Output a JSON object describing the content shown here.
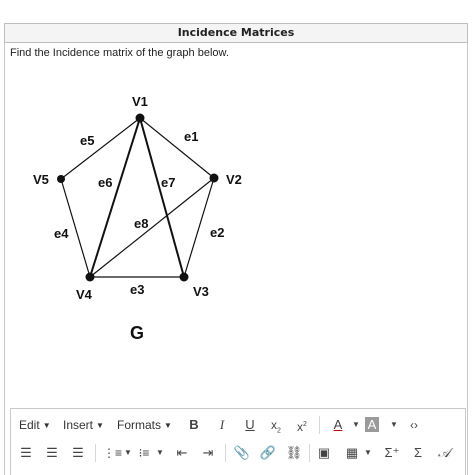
{
  "panel": {
    "title": "Incidence Matrices",
    "question": "Find the Incidence matrix of the graph below."
  },
  "graph": {
    "vertices": [
      {
        "id": "v1",
        "label": "V1"
      },
      {
        "id": "v2",
        "label": "V2"
      },
      {
        "id": "v3",
        "label": "V3"
      },
      {
        "id": "v4",
        "label": "V4"
      },
      {
        "id": "v5",
        "label": "V5"
      }
    ],
    "edges": [
      {
        "id": "e1",
        "label": "e1",
        "from": "v1",
        "to": "v2"
      },
      {
        "id": "e2",
        "label": "e2",
        "from": "v2",
        "to": "v3"
      },
      {
        "id": "e3",
        "label": "e3",
        "from": "v3",
        "to": "v4"
      },
      {
        "id": "e4",
        "label": "e4",
        "from": "v4",
        "to": "v5"
      },
      {
        "id": "e5",
        "label": "e5",
        "from": "v5",
        "to": "v1"
      },
      {
        "id": "e6",
        "label": "e6",
        "from": "v1",
        "to": "v4"
      },
      {
        "id": "e7",
        "label": "e7",
        "from": "v1",
        "to": "v3"
      },
      {
        "id": "e8",
        "label": "e8",
        "from": "v4",
        "to": "v2"
      }
    ],
    "graph_name": "G"
  },
  "toolbar": {
    "edit_label": "Edit",
    "insert_label": "Insert",
    "formats_label": "Formats",
    "row1_icons": [
      "bold-icon",
      "italic-icon",
      "underline-icon",
      "subscript-icon",
      "superscript-icon",
      "text-color-icon",
      "background-color-icon",
      "code-view-icon"
    ],
    "row2_icons": [
      "align-left-icon",
      "align-center-icon",
      "align-right-icon",
      "bullet-list-icon",
      "numbered-list-icon",
      "outdent-icon",
      "indent-icon",
      "attachment-icon",
      "link-icon",
      "unlink-icon",
      "image-icon",
      "table-icon",
      "equation-icon",
      "sum-icon",
      "handwriting-icon"
    ]
  }
}
